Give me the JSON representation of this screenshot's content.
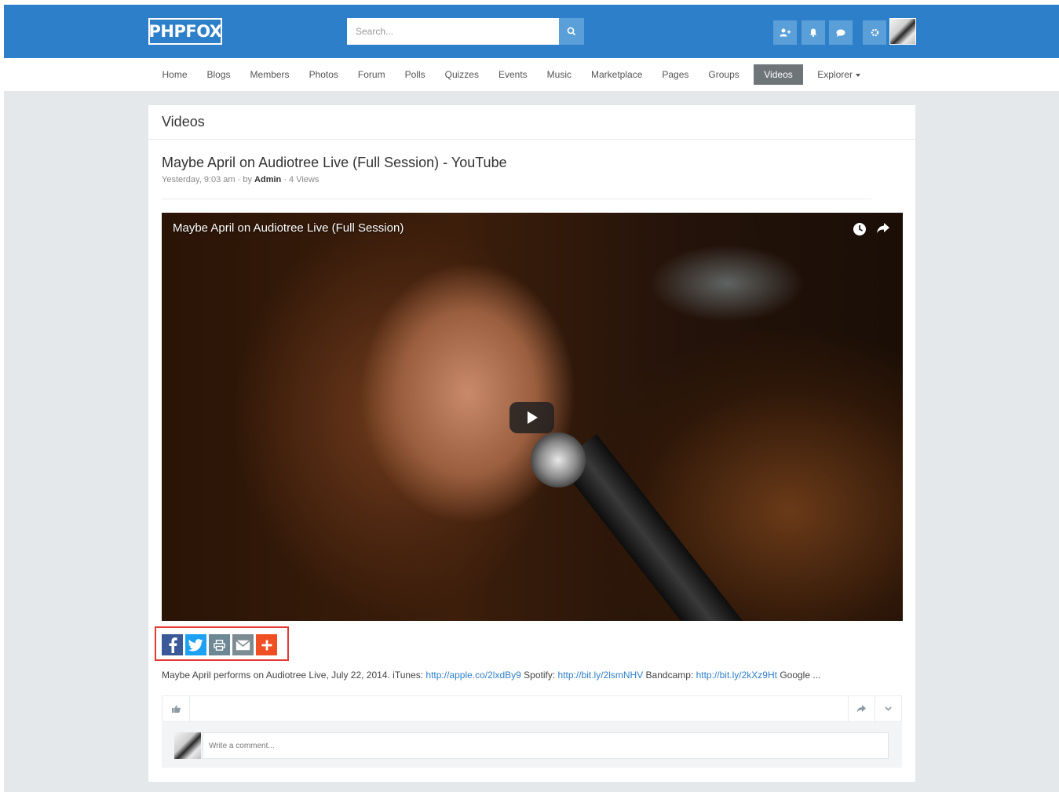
{
  "header": {
    "logo": "PHPFOX",
    "search_placeholder": "Search...",
    "icons": [
      "search-icon",
      "add-friend-icon",
      "bell-icon",
      "chat-icon",
      "gear-icon"
    ]
  },
  "nav": {
    "items": [
      "Home",
      "Blogs",
      "Members",
      "Photos",
      "Forum",
      "Polls",
      "Quizzes",
      "Events",
      "Music",
      "Marketplace",
      "Pages",
      "Groups",
      "Videos",
      "Explorer"
    ],
    "active": "Videos"
  },
  "section_title": "Videos",
  "video": {
    "title": "Maybe April on Audiotree Live (Full Session) - YouTube",
    "date": "Yesterday, 9:03 am",
    "by_prefix": "· by",
    "author": "Admin",
    "views": "· 4 Views",
    "player_title": "Maybe April on Audiotree Live (Full Session)"
  },
  "share": {
    "buttons": [
      "facebook",
      "twitter",
      "print",
      "email",
      "more"
    ],
    "colors": {
      "facebook": "#3b5998",
      "twitter": "#1da1f2",
      "print": "#6d8795",
      "email": "#7d8c93",
      "more": "#f04e23"
    }
  },
  "description": {
    "t1": "Maybe April performs on Audiotree Live, July 22, 2014. iTunes: ",
    "l1": "http://apple.co/2lxdBy9",
    "t2": " Spotify: ",
    "l2": "http://bit.ly/2lsmNHV",
    "t3": " Bandcamp: ",
    "l3": "http://bit.ly/2kXz9Ht",
    "t4": " Google ..."
  },
  "comment": {
    "placeholder": "Write a comment..."
  },
  "colors": {
    "brand": "#2e7fc9",
    "header_button": "#5b9fd8",
    "active_nav": "#6e7579",
    "highlight_box": "#e53935"
  }
}
